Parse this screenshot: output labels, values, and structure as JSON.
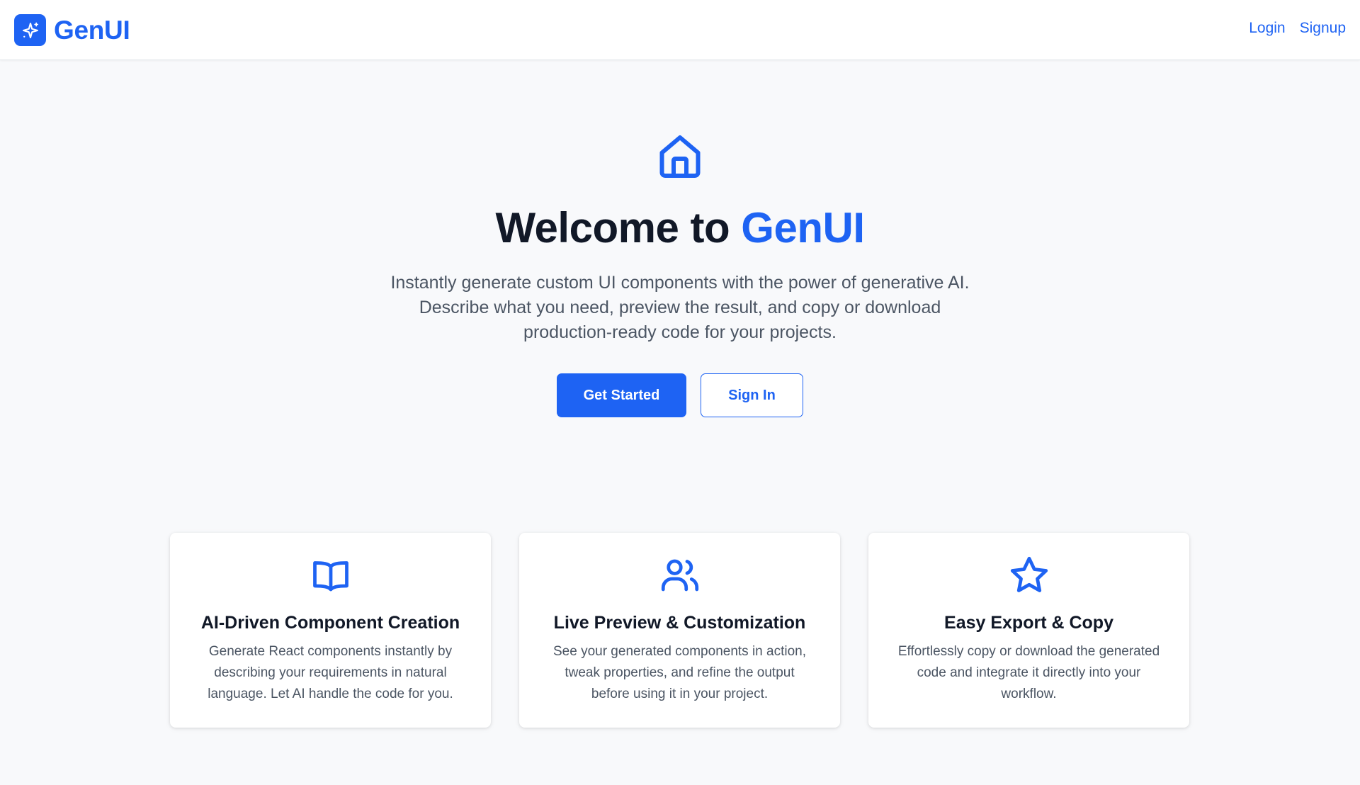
{
  "navbar": {
    "brand": "GenUI",
    "links": [
      "Login",
      "Signup"
    ]
  },
  "hero": {
    "icon": "home-icon",
    "title_prefix": "Welcome to ",
    "title_accent": "GenUI",
    "description": "Instantly generate custom UI components with the power of generative AI. Describe what you need, preview the result, and copy or download production-ready code for your projects.",
    "primary_button": "Get Started",
    "secondary_button": "Sign In"
  },
  "features": [
    {
      "icon": "book-open-icon",
      "title": "AI-Driven Component Creation",
      "description": "Generate React components instantly by describing your requirements in natural language. Let AI handle the code for you."
    },
    {
      "icon": "users-icon",
      "title": "Live Preview & Customization",
      "description": "See your generated components in action, tweak properties, and refine the output before using it in your project."
    },
    {
      "icon": "star-icon",
      "title": "Easy Export & Copy",
      "description": "Effortlessly copy or download the generated code and integrate it directly into your workflow."
    }
  ],
  "colors": {
    "accent": "#1e63f3",
    "background": "#f8f9fb",
    "text": "#111827",
    "muted_text": "#4b5563"
  }
}
